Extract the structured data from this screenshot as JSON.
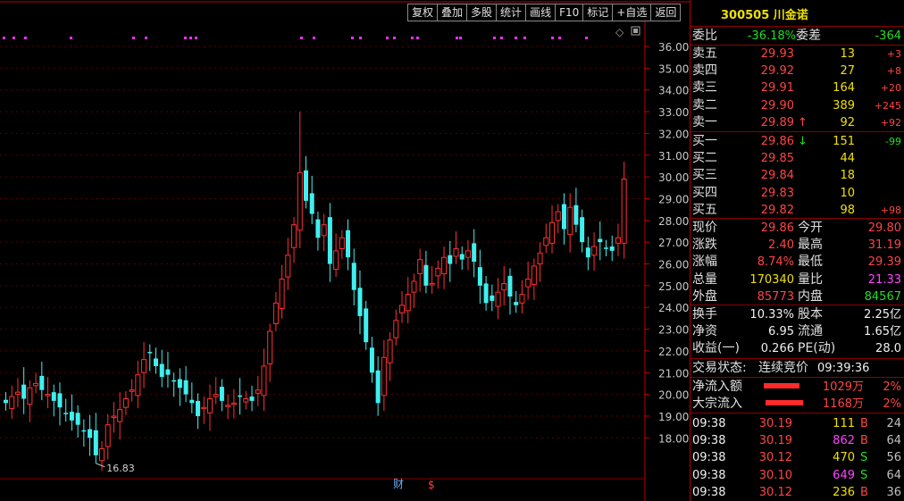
{
  "toolbar": {
    "buttons": [
      "复权",
      "叠加",
      "多股",
      "统计",
      "画线",
      "F10",
      "标记",
      "+自选",
      "返回"
    ]
  },
  "stock": {
    "code": "300505",
    "name": "川金诺"
  },
  "chart": {
    "y_ticks": [
      "36.00",
      "35.00",
      "34.00",
      "33.00",
      "32.00",
      "31.00",
      "30.00",
      "29.00",
      "28.00",
      "27.00",
      "26.00",
      "25.00",
      "24.00",
      "23.00",
      "22.00",
      "21.00",
      "20.00",
      "19.00",
      "18.00"
    ],
    "low_marker": "16.83",
    "finance_marker": "财",
    "money_marker": "$",
    "up_color": "#ff3030",
    "down_color": "#40f0f0",
    "signal_color": "#ff30ff"
  },
  "ratio": {
    "wb_label": "委比",
    "wb_value": "-36.18%",
    "wc_label": "委差",
    "wc_value": "-364"
  },
  "sell": [
    {
      "label": "卖五",
      "price": "29.93",
      "vol": "13",
      "chg": "+3"
    },
    {
      "label": "卖四",
      "price": "29.92",
      "vol": "27",
      "chg": "+8"
    },
    {
      "label": "卖三",
      "price": "29.91",
      "vol": "164",
      "chg": "+20"
    },
    {
      "label": "卖二",
      "price": "29.90",
      "vol": "389",
      "chg": "+245"
    },
    {
      "label": "卖一",
      "price": "29.89",
      "vol": "92",
      "chg": "+92"
    }
  ],
  "buy": [
    {
      "label": "买一",
      "price": "29.86",
      "vol": "151",
      "chg": "-99"
    },
    {
      "label": "买二",
      "price": "29.85",
      "vol": "44",
      "chg": ""
    },
    {
      "label": "买三",
      "price": "29.84",
      "vol": "18",
      "chg": ""
    },
    {
      "label": "买四",
      "price": "29.83",
      "vol": "10",
      "chg": ""
    },
    {
      "label": "买五",
      "price": "29.82",
      "vol": "98",
      "chg": "+98"
    }
  ],
  "quote": [
    {
      "l1": "现价",
      "v1": "29.86",
      "l2": "今开",
      "v2": "29.80"
    },
    {
      "l1": "涨跌",
      "v1": "2.40",
      "l2": "最高",
      "v2": "31.19"
    },
    {
      "l1": "涨幅",
      "v1": "8.74%",
      "l2": "最低",
      "v2": "29.39"
    },
    {
      "l1": "总量",
      "v1": "170340",
      "l2": "量比",
      "v2": "21.33"
    },
    {
      "l1": "外盘",
      "v1": "85773",
      "l2": "内盘",
      "v2": "84567"
    }
  ],
  "fin": [
    {
      "l1": "换手",
      "v1": "10.33%",
      "l2": "股本",
      "v2": "2.25亿"
    },
    {
      "l1": "净资",
      "v1": "6.95",
      "l2": "流通",
      "v2": "1.65亿"
    },
    {
      "l1": "收益(一)",
      "v1": "0.266",
      "l2": "PE(动)",
      "v2": "28.0"
    }
  ],
  "status": {
    "label": "交易状态:",
    "value": "连续竞价",
    "time": "09:39:36"
  },
  "flows": [
    {
      "label": "净流入额",
      "amount": "1029万",
      "pct": "2%"
    },
    {
      "label": "大宗流入",
      "amount": "1168万",
      "pct": "2%"
    }
  ],
  "ticks": [
    {
      "time": "09:38",
      "price": "30.19",
      "vol": "111",
      "side": "B",
      "n": "24"
    },
    {
      "time": "09:38",
      "price": "30.19",
      "vol": "862",
      "side": "B",
      "n": "64"
    },
    {
      "time": "09:38",
      "price": "30.12",
      "vol": "470",
      "side": "S",
      "n": "56"
    },
    {
      "time": "09:38",
      "price": "30.10",
      "vol": "649",
      "side": "S",
      "n": "64"
    },
    {
      "time": "09:38",
      "price": "30.12",
      "vol": "236",
      "side": "B",
      "n": "36"
    }
  ]
}
